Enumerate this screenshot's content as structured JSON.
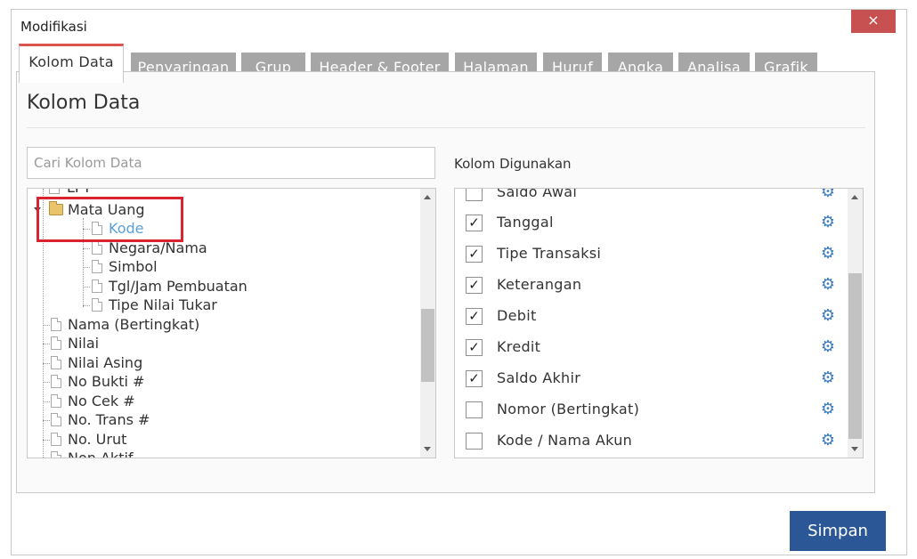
{
  "window": {
    "title": "Modifikasi",
    "close_label": "×"
  },
  "tabs": [
    {
      "label": "Kolom Data",
      "active": true
    },
    {
      "label": "Penyaringan",
      "active": false
    },
    {
      "label": "Grup",
      "active": false
    },
    {
      "label": "Header & Footer",
      "active": false
    },
    {
      "label": "Halaman",
      "active": false
    },
    {
      "label": "Huruf",
      "active": false
    },
    {
      "label": "Angka",
      "active": false
    },
    {
      "label": "Analisa",
      "active": false
    },
    {
      "label": "Grafik",
      "active": false
    }
  ],
  "panel": {
    "heading": "Kolom Data",
    "search_placeholder": "Cari Kolom Data",
    "used_label": "Kolom Digunakan"
  },
  "tree": {
    "partial_top": "LFT",
    "folder": {
      "label": "Mata Uang",
      "expanded": true
    },
    "folder_children": [
      {
        "label": "Kode",
        "selected": true
      },
      {
        "label": "Negara/Nama",
        "selected": false
      },
      {
        "label": "Simbol",
        "selected": false
      },
      {
        "label": "Tgl/Jam Pembuatan",
        "selected": false
      },
      {
        "label": "Tipe Nilai Tukar",
        "selected": false
      }
    ],
    "items": [
      {
        "label": "Nama (Bertingkat)"
      },
      {
        "label": "Nilai"
      },
      {
        "label": "Nilai Asing"
      },
      {
        "label": "No Bukti #"
      },
      {
        "label": "No Cek #"
      },
      {
        "label": "No. Trans #"
      },
      {
        "label": "No. Urut"
      }
    ],
    "partial_bottom": "Non Aktif",
    "colors": {
      "selected_text": "#5aa0d8"
    }
  },
  "columns_used": {
    "partial_top": {
      "label": "Saldo Awal",
      "checked": false
    },
    "rows": [
      {
        "label": "Tanggal",
        "checked": true
      },
      {
        "label": "Tipe Transaksi",
        "checked": true
      },
      {
        "label": "Keterangan",
        "checked": true
      },
      {
        "label": "Debit",
        "checked": true
      },
      {
        "label": "Kredit",
        "checked": true
      },
      {
        "label": "Saldo Akhir",
        "checked": true
      },
      {
        "label": "Nomor (Bertingkat)",
        "checked": false
      },
      {
        "label": "Kode / Nama Akun",
        "checked": false
      }
    ],
    "check_mark": "✓",
    "gear_icon": "gear-icon"
  },
  "footer": {
    "save_label": "Simpan"
  }
}
